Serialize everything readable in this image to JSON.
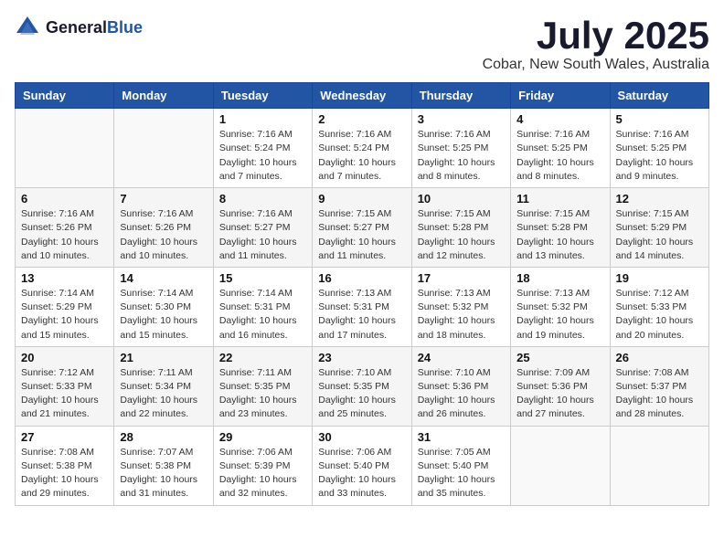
{
  "header": {
    "logo_general": "General",
    "logo_blue": "Blue",
    "month_title": "July 2025",
    "location": "Cobar, New South Wales, Australia"
  },
  "weekdays": [
    "Sunday",
    "Monday",
    "Tuesday",
    "Wednesday",
    "Thursday",
    "Friday",
    "Saturday"
  ],
  "weeks": [
    [
      {
        "day": "",
        "sunrise": "",
        "sunset": "",
        "daylight": ""
      },
      {
        "day": "",
        "sunrise": "",
        "sunset": "",
        "daylight": ""
      },
      {
        "day": "1",
        "sunrise": "Sunrise: 7:16 AM",
        "sunset": "Sunset: 5:24 PM",
        "daylight": "Daylight: 10 hours and 7 minutes."
      },
      {
        "day": "2",
        "sunrise": "Sunrise: 7:16 AM",
        "sunset": "Sunset: 5:24 PM",
        "daylight": "Daylight: 10 hours and 7 minutes."
      },
      {
        "day": "3",
        "sunrise": "Sunrise: 7:16 AM",
        "sunset": "Sunset: 5:25 PM",
        "daylight": "Daylight: 10 hours and 8 minutes."
      },
      {
        "day": "4",
        "sunrise": "Sunrise: 7:16 AM",
        "sunset": "Sunset: 5:25 PM",
        "daylight": "Daylight: 10 hours and 8 minutes."
      },
      {
        "day": "5",
        "sunrise": "Sunrise: 7:16 AM",
        "sunset": "Sunset: 5:25 PM",
        "daylight": "Daylight: 10 hours and 9 minutes."
      }
    ],
    [
      {
        "day": "6",
        "sunrise": "Sunrise: 7:16 AM",
        "sunset": "Sunset: 5:26 PM",
        "daylight": "Daylight: 10 hours and 10 minutes."
      },
      {
        "day": "7",
        "sunrise": "Sunrise: 7:16 AM",
        "sunset": "Sunset: 5:26 PM",
        "daylight": "Daylight: 10 hours and 10 minutes."
      },
      {
        "day": "8",
        "sunrise": "Sunrise: 7:16 AM",
        "sunset": "Sunset: 5:27 PM",
        "daylight": "Daylight: 10 hours and 11 minutes."
      },
      {
        "day": "9",
        "sunrise": "Sunrise: 7:15 AM",
        "sunset": "Sunset: 5:27 PM",
        "daylight": "Daylight: 10 hours and 11 minutes."
      },
      {
        "day": "10",
        "sunrise": "Sunrise: 7:15 AM",
        "sunset": "Sunset: 5:28 PM",
        "daylight": "Daylight: 10 hours and 12 minutes."
      },
      {
        "day": "11",
        "sunrise": "Sunrise: 7:15 AM",
        "sunset": "Sunset: 5:28 PM",
        "daylight": "Daylight: 10 hours and 13 minutes."
      },
      {
        "day": "12",
        "sunrise": "Sunrise: 7:15 AM",
        "sunset": "Sunset: 5:29 PM",
        "daylight": "Daylight: 10 hours and 14 minutes."
      }
    ],
    [
      {
        "day": "13",
        "sunrise": "Sunrise: 7:14 AM",
        "sunset": "Sunset: 5:29 PM",
        "daylight": "Daylight: 10 hours and 15 minutes."
      },
      {
        "day": "14",
        "sunrise": "Sunrise: 7:14 AM",
        "sunset": "Sunset: 5:30 PM",
        "daylight": "Daylight: 10 hours and 15 minutes."
      },
      {
        "day": "15",
        "sunrise": "Sunrise: 7:14 AM",
        "sunset": "Sunset: 5:31 PM",
        "daylight": "Daylight: 10 hours and 16 minutes."
      },
      {
        "day": "16",
        "sunrise": "Sunrise: 7:13 AM",
        "sunset": "Sunset: 5:31 PM",
        "daylight": "Daylight: 10 hours and 17 minutes."
      },
      {
        "day": "17",
        "sunrise": "Sunrise: 7:13 AM",
        "sunset": "Sunset: 5:32 PM",
        "daylight": "Daylight: 10 hours and 18 minutes."
      },
      {
        "day": "18",
        "sunrise": "Sunrise: 7:13 AM",
        "sunset": "Sunset: 5:32 PM",
        "daylight": "Daylight: 10 hours and 19 minutes."
      },
      {
        "day": "19",
        "sunrise": "Sunrise: 7:12 AM",
        "sunset": "Sunset: 5:33 PM",
        "daylight": "Daylight: 10 hours and 20 minutes."
      }
    ],
    [
      {
        "day": "20",
        "sunrise": "Sunrise: 7:12 AM",
        "sunset": "Sunset: 5:33 PM",
        "daylight": "Daylight: 10 hours and 21 minutes."
      },
      {
        "day": "21",
        "sunrise": "Sunrise: 7:11 AM",
        "sunset": "Sunset: 5:34 PM",
        "daylight": "Daylight: 10 hours and 22 minutes."
      },
      {
        "day": "22",
        "sunrise": "Sunrise: 7:11 AM",
        "sunset": "Sunset: 5:35 PM",
        "daylight": "Daylight: 10 hours and 23 minutes."
      },
      {
        "day": "23",
        "sunrise": "Sunrise: 7:10 AM",
        "sunset": "Sunset: 5:35 PM",
        "daylight": "Daylight: 10 hours and 25 minutes."
      },
      {
        "day": "24",
        "sunrise": "Sunrise: 7:10 AM",
        "sunset": "Sunset: 5:36 PM",
        "daylight": "Daylight: 10 hours and 26 minutes."
      },
      {
        "day": "25",
        "sunrise": "Sunrise: 7:09 AM",
        "sunset": "Sunset: 5:36 PM",
        "daylight": "Daylight: 10 hours and 27 minutes."
      },
      {
        "day": "26",
        "sunrise": "Sunrise: 7:08 AM",
        "sunset": "Sunset: 5:37 PM",
        "daylight": "Daylight: 10 hours and 28 minutes."
      }
    ],
    [
      {
        "day": "27",
        "sunrise": "Sunrise: 7:08 AM",
        "sunset": "Sunset: 5:38 PM",
        "daylight": "Daylight: 10 hours and 29 minutes."
      },
      {
        "day": "28",
        "sunrise": "Sunrise: 7:07 AM",
        "sunset": "Sunset: 5:38 PM",
        "daylight": "Daylight: 10 hours and 31 minutes."
      },
      {
        "day": "29",
        "sunrise": "Sunrise: 7:06 AM",
        "sunset": "Sunset: 5:39 PM",
        "daylight": "Daylight: 10 hours and 32 minutes."
      },
      {
        "day": "30",
        "sunrise": "Sunrise: 7:06 AM",
        "sunset": "Sunset: 5:40 PM",
        "daylight": "Daylight: 10 hours and 33 minutes."
      },
      {
        "day": "31",
        "sunrise": "Sunrise: 7:05 AM",
        "sunset": "Sunset: 5:40 PM",
        "daylight": "Daylight: 10 hours and 35 minutes."
      },
      {
        "day": "",
        "sunrise": "",
        "sunset": "",
        "daylight": ""
      },
      {
        "day": "",
        "sunrise": "",
        "sunset": "",
        "daylight": ""
      }
    ]
  ]
}
